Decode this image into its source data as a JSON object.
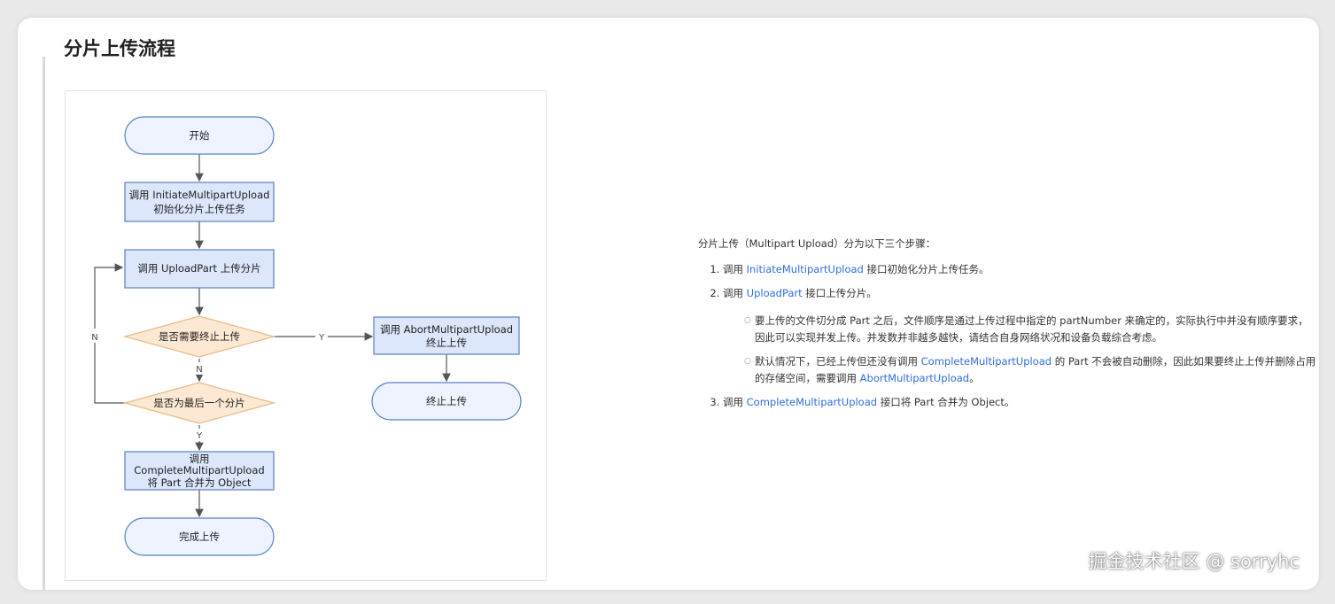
{
  "page_title": "分片上传流程",
  "flowchart": {
    "start": "开始",
    "initiate_line1": "调用 InitiateMultipartUpload",
    "initiate_line2": "初始化分片上传任务",
    "upload_part": "调用 UploadPart 上传分片",
    "decision_abort": "是否需要终止上传",
    "decision_last": "是否为最后一个分片",
    "abort_line1": "调用 AbortMultipartUpload",
    "abort_line2": "终止上传",
    "abort_end": "终止上传",
    "complete_line1": "调用",
    "complete_line2": "CompleteMultipartUpload",
    "complete_line3": "将 Part 合并为 Object",
    "finish": "完成上传",
    "label_y": "Y",
    "label_n": "N",
    "colors": {
      "terminal_fill": "#eef3ff",
      "process_fill": "#dce7fb",
      "decision_fill": "#fde9d3",
      "stroke": "#5b7fc6",
      "decision_stroke": "#e9b985",
      "edge": "#555555"
    }
  },
  "steps": {
    "intro": "分片上传（Multipart Upload）分为以下三个步骤：",
    "s1_prefix": "调用 ",
    "s1_link": "InitiateMultipartUpload",
    "s1_suffix": " 接口初始化分片上传任务。",
    "s2_prefix": "调用 ",
    "s2_link": "UploadPart",
    "s2_suffix": " 接口上传分片。",
    "s2_b1": "要上传的文件切分成 Part 之后，文件顺序是通过上传过程中指定的 partNumber 来确定的，实际执行中并没有顺序要求，因此可以实现并发上传。并发数并非越多越快，请结合自身网络状况和设备负载综合考虑。",
    "s2_b2_prefix": "默认情况下，已经上传但还没有调用 ",
    "s2_b2_link1": "CompleteMultipartUpload",
    "s2_b2_mid": " 的 Part 不会被自动删除，因此如果要终止上传并删除占用的存储空间，需要调用 ",
    "s2_b2_link2": "AbortMultipartUpload",
    "s2_b2_suffix": "。",
    "s3_prefix": "调用 ",
    "s3_link": "CompleteMultipartUpload",
    "s3_suffix": " 接口将 Part 合并为 Object。",
    "bullet_glyph": "○"
  },
  "watermark": "掘金技术社区 @ sorryhc"
}
